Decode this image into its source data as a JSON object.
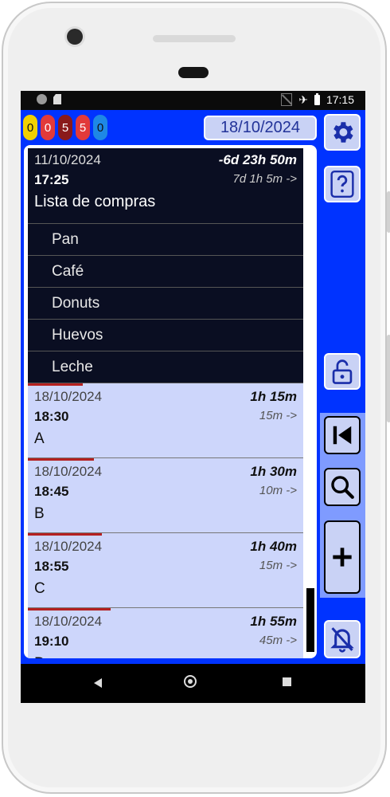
{
  "status": {
    "time": "17:15"
  },
  "counters": [
    {
      "value": "0",
      "bg": "#f2d100",
      "fg": "#111111"
    },
    {
      "value": "0",
      "bg": "#e23a3a",
      "fg": "#ffffff"
    },
    {
      "value": "5",
      "bg": "#8a1a1a",
      "fg": "#ffffff"
    },
    {
      "value": "5",
      "bg": "#e23a3a",
      "fg": "#ffffff"
    },
    {
      "value": "0",
      "bg": "#1e88e5",
      "fg": "#111111"
    }
  ],
  "header": {
    "date": "18/10/2024"
  },
  "list": {
    "head": {
      "date": "11/10/2024",
      "time": "17:25",
      "duration": "-6d 23h 50m",
      "remaining": "7d 1h 5m ->",
      "title": "Lista de compras",
      "items": [
        "Pan",
        "Café",
        "Donuts",
        "Huevos",
        "Leche"
      ]
    },
    "events": [
      {
        "date": "18/10/2024",
        "time": "18:30",
        "duration": "1h 15m",
        "remaining": "15m ->",
        "title": "A",
        "progress": 0.2
      },
      {
        "date": "18/10/2024",
        "time": "18:45",
        "duration": "1h 30m",
        "remaining": "10m ->",
        "title": "B",
        "progress": 0.24
      },
      {
        "date": "18/10/2024",
        "time": "18:55",
        "duration": "1h 40m",
        "remaining": "15m ->",
        "title": "C",
        "progress": 0.27
      },
      {
        "date": "18/10/2024",
        "time": "19:10",
        "duration": "1h 55m",
        "remaining": "45m ->",
        "title": "D",
        "progress": 0.3
      }
    ]
  },
  "icons": {
    "settings": "gear-icon",
    "help": "question-icon",
    "lock": "lock-open-icon",
    "first": "skip-to-start-icon",
    "search": "magnifier-icon",
    "add": "plus-icon",
    "bell": "bell-off-icon"
  },
  "colors": {
    "accent": "#0033ff",
    "button_bg": "#c9d2f5",
    "event_bg": "#cdd6fb",
    "head_bg": "#0a0e22",
    "progress": "#b42020"
  }
}
